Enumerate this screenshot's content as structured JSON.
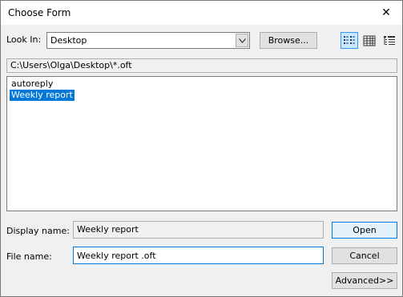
{
  "window": {
    "title": "Choose Form",
    "close_symbol": "✕"
  },
  "look_in": {
    "label": "Look In:",
    "value": "Desktop"
  },
  "toolbar": {
    "browse_label": "Browse..."
  },
  "views": [
    "list-view-icon",
    "details-view-icon",
    "properties-view-icon"
  ],
  "path": "C:\\Users\\Olga\\Desktop\\*.oft",
  "forms": [
    {
      "name": "autoreply",
      "selected": false
    },
    {
      "name": "Weekly report",
      "selected": true
    }
  ],
  "display_name": {
    "label": "Display name:",
    "value": "Weekly report"
  },
  "file_name": {
    "label": "File name:",
    "value": "Weekly report .oft"
  },
  "buttons": {
    "open": "Open",
    "cancel": "Cancel",
    "advanced": "Advanced>>"
  },
  "colors": {
    "selection": "#0078d7",
    "focus_border": "#0078d7",
    "dialog_bg": "#f0f0f0"
  }
}
